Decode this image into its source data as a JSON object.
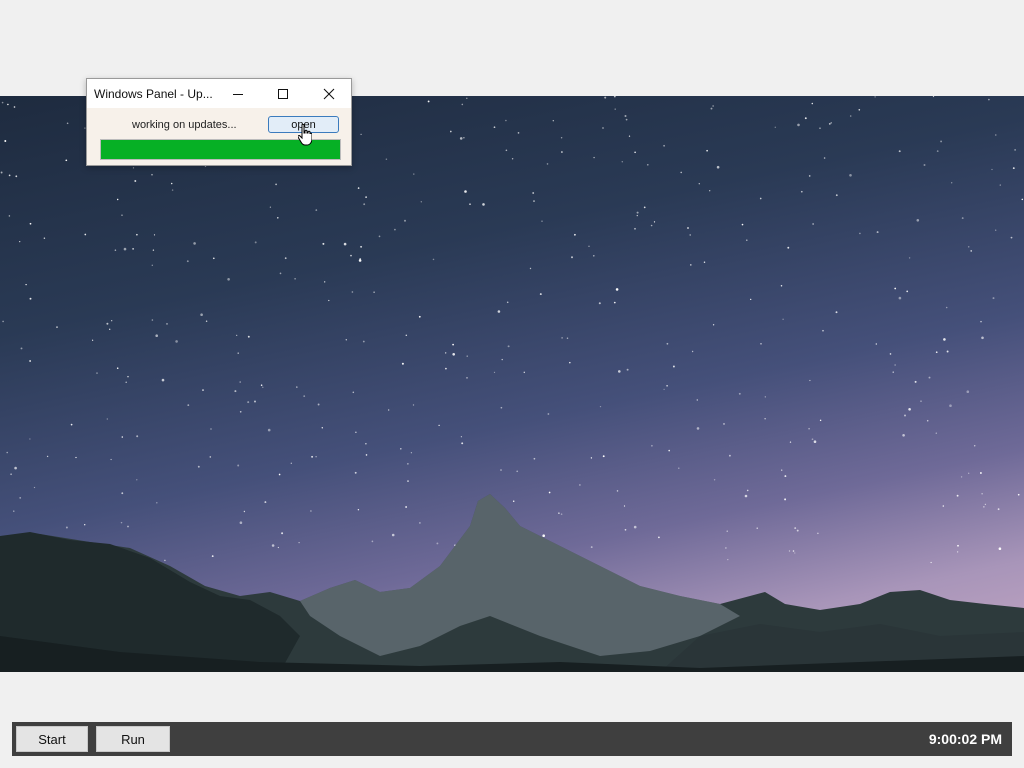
{
  "desktop": {
    "background_color": "#f0f0f0",
    "wallpaper": "starry-night-mountain-wallpaper"
  },
  "dialog": {
    "title": "Windows Panel - Up...",
    "status_text": "working on updates...",
    "open_label": "open",
    "progress": 1.0,
    "progress_color": "#06b025",
    "controls": [
      "minimize-icon",
      "maximize-icon",
      "close-icon"
    ]
  },
  "taskbar": {
    "start_label": "Start",
    "run_label": "Run",
    "clock": "9:00:02 PM",
    "color": "#3f3f3f"
  }
}
